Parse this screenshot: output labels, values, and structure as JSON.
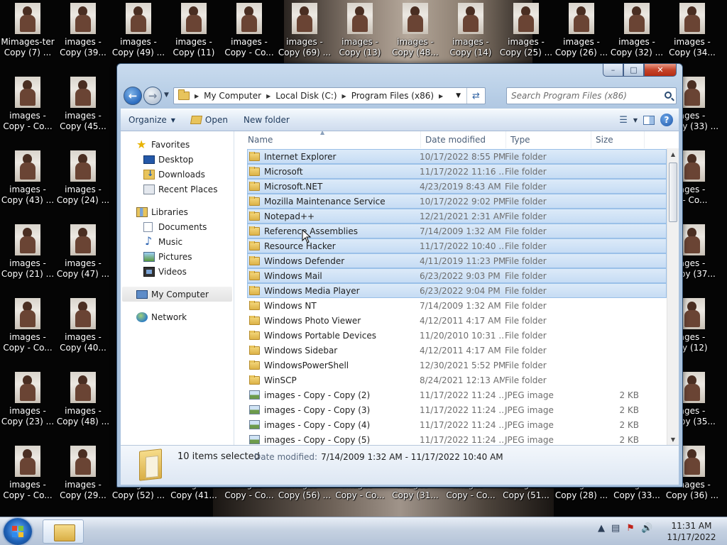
{
  "desktop": {
    "icons": [
      {
        "label": "Mimages-ter\nCopy (7) ..."
      },
      {
        "label": "images -\nCopy (39..."
      },
      {
        "label": "images -\nCopy (49) ..."
      },
      {
        "label": "images -\nCopy (11)"
      },
      {
        "label": "images -\nCopy - Co..."
      },
      {
        "label": "images -\nCopy (69) ..."
      },
      {
        "label": "images -\nCopy (13)"
      },
      {
        "label": "images -\nCopy (48..."
      },
      {
        "label": "images -\nCopy (14)"
      },
      {
        "label": "images -\nCopy (25) ..."
      },
      {
        "label": "images -\nCopy (26) ..."
      },
      {
        "label": "images -\nCopy (32) ..."
      },
      {
        "label": "images -\nCopy (34..."
      },
      {
        "label": "images -\nCopy - Co..."
      },
      {
        "label": "images -\nCopy (45..."
      },
      {
        "label": "images -\nCopy (43) ..."
      },
      {
        "label": "images -\nCopy (24) ..."
      },
      {
        "label": "images -\nCopy (21) ..."
      },
      {
        "label": "images -\nCopy (47) ..."
      },
      {
        "label": "images -\nCopy - Co..."
      },
      {
        "label": "images -\nCopy (40..."
      },
      {
        "label": "images -\nCopy (23) ..."
      },
      {
        "label": "images -\nCopy (48) ..."
      },
      {
        "label": "images -\nCopy - Co..."
      },
      {
        "label": "images -\nCopy (29..."
      },
      {
        "label": "images -\nCopy (52) ..."
      },
      {
        "label": "images -\nCopy (41..."
      },
      {
        "label": "images -\nCopy - Co..."
      },
      {
        "label": "images -\nCopy (56) ..."
      },
      {
        "label": "images -\nCopy - Co..."
      },
      {
        "label": "images -\nCopy (31..."
      },
      {
        "label": "images -\nCopy - Co..."
      },
      {
        "label": "images -\nCopy (51..."
      },
      {
        "label": "images -\nCopy (28) ..."
      },
      {
        "label": "images -\nCopy (33..."
      },
      {
        "label": "images -\nCopy (36) ..."
      },
      {
        "label": "ages -\nCopy (33) ..."
      },
      {
        "label": "ages -\n/ - Co..."
      },
      {
        "label": "ages -\nCopy (37..."
      },
      {
        "label": "ages -\npy (12)"
      },
      {
        "label": "ages -\nCopy (35..."
      }
    ]
  },
  "window": {
    "address": {
      "crumbs": [
        "My Computer",
        "Local Disk (C:)",
        "Program Files (x86)"
      ]
    },
    "search": {
      "placeholder": "Search Program Files (x86)"
    },
    "toolbar": {
      "organize": "Organize",
      "open": "Open",
      "new_folder": "New folder"
    },
    "nav": {
      "favorites": "Favorites",
      "desktop": "Desktop",
      "downloads": "Downloads",
      "recent": "Recent Places",
      "libraries": "Libraries",
      "documents": "Documents",
      "music": "Music",
      "pictures": "Pictures",
      "videos": "Videos",
      "computer": "My Computer",
      "network": "Network"
    },
    "columns": {
      "name": "Name",
      "date": "Date modified",
      "type": "Type",
      "size": "Size"
    },
    "files": [
      {
        "name": "Internet Explorer",
        "date": "10/17/2022 8:55 PM",
        "type": "File folder",
        "size": "",
        "kind": "folder",
        "selected": true
      },
      {
        "name": "Microsoft",
        "date": "11/17/2022 11:16 ...",
        "type": "File folder",
        "size": "",
        "kind": "folder",
        "selected": true
      },
      {
        "name": "Microsoft.NET",
        "date": "4/23/2019 8:43 AM",
        "type": "File folder",
        "size": "",
        "kind": "folder",
        "selected": true
      },
      {
        "name": "Mozilla Maintenance Service",
        "date": "10/17/2022 9:02 PM",
        "type": "File folder",
        "size": "",
        "kind": "folder",
        "selected": true
      },
      {
        "name": "Notepad++",
        "date": "12/21/2021 2:31 AM",
        "type": "File folder",
        "size": "",
        "kind": "folder",
        "selected": true
      },
      {
        "name": "Reference Assemblies",
        "date": "7/14/2009 1:32 AM",
        "type": "File folder",
        "size": "",
        "kind": "folder",
        "selected": true
      },
      {
        "name": "Resource Hacker",
        "date": "11/17/2022 10:40 ...",
        "type": "File folder",
        "size": "",
        "kind": "folder",
        "selected": true
      },
      {
        "name": "Windows Defender",
        "date": "4/11/2019 11:23 PM",
        "type": "File folder",
        "size": "",
        "kind": "folder",
        "selected": true
      },
      {
        "name": "Windows Mail",
        "date": "6/23/2022 9:03 PM",
        "type": "File folder",
        "size": "",
        "kind": "folder",
        "selected": true
      },
      {
        "name": "Windows Media Player",
        "date": "6/23/2022 9:04 PM",
        "type": "File folder",
        "size": "",
        "kind": "folder",
        "selected": true
      },
      {
        "name": "Windows NT",
        "date": "7/14/2009 1:32 AM",
        "type": "File folder",
        "size": "",
        "kind": "folder",
        "selected": false
      },
      {
        "name": "Windows Photo Viewer",
        "date": "4/12/2011 4:17 AM",
        "type": "File folder",
        "size": "",
        "kind": "folder",
        "selected": false
      },
      {
        "name": "Windows Portable Devices",
        "date": "11/20/2010 10:31 ...",
        "type": "File folder",
        "size": "",
        "kind": "folder",
        "selected": false
      },
      {
        "name": "Windows Sidebar",
        "date": "4/12/2011 4:17 AM",
        "type": "File folder",
        "size": "",
        "kind": "folder",
        "selected": false
      },
      {
        "name": "WindowsPowerShell",
        "date": "12/30/2021 5:52 PM",
        "type": "File folder",
        "size": "",
        "kind": "folder",
        "selected": false
      },
      {
        "name": "WinSCP",
        "date": "8/24/2021 12:13 AM",
        "type": "File folder",
        "size": "",
        "kind": "folder",
        "selected": false
      },
      {
        "name": "images - Copy - Copy (2)",
        "date": "11/17/2022 11:24 ...",
        "type": "JPEG image",
        "size": "2 KB",
        "kind": "jpeg",
        "selected": false
      },
      {
        "name": "images - Copy - Copy (3)",
        "date": "11/17/2022 11:24 ...",
        "type": "JPEG image",
        "size": "2 KB",
        "kind": "jpeg",
        "selected": false
      },
      {
        "name": "images - Copy - Copy (4)",
        "date": "11/17/2022 11:24 ...",
        "type": "JPEG image",
        "size": "2 KB",
        "kind": "jpeg",
        "selected": false
      },
      {
        "name": "images - Copy - Copy (5)",
        "date": "11/17/2022 11:24 ...",
        "type": "JPEG image",
        "size": "2 KB",
        "kind": "jpeg",
        "selected": false
      }
    ],
    "details": {
      "count": "10 items selected",
      "date_label": "Date modified:",
      "date_range": "7/14/2009 1:32 AM - 11/17/2022 10:40 AM"
    }
  },
  "taskbar": {
    "time": "11:31 AM",
    "date": "11/17/2022"
  }
}
